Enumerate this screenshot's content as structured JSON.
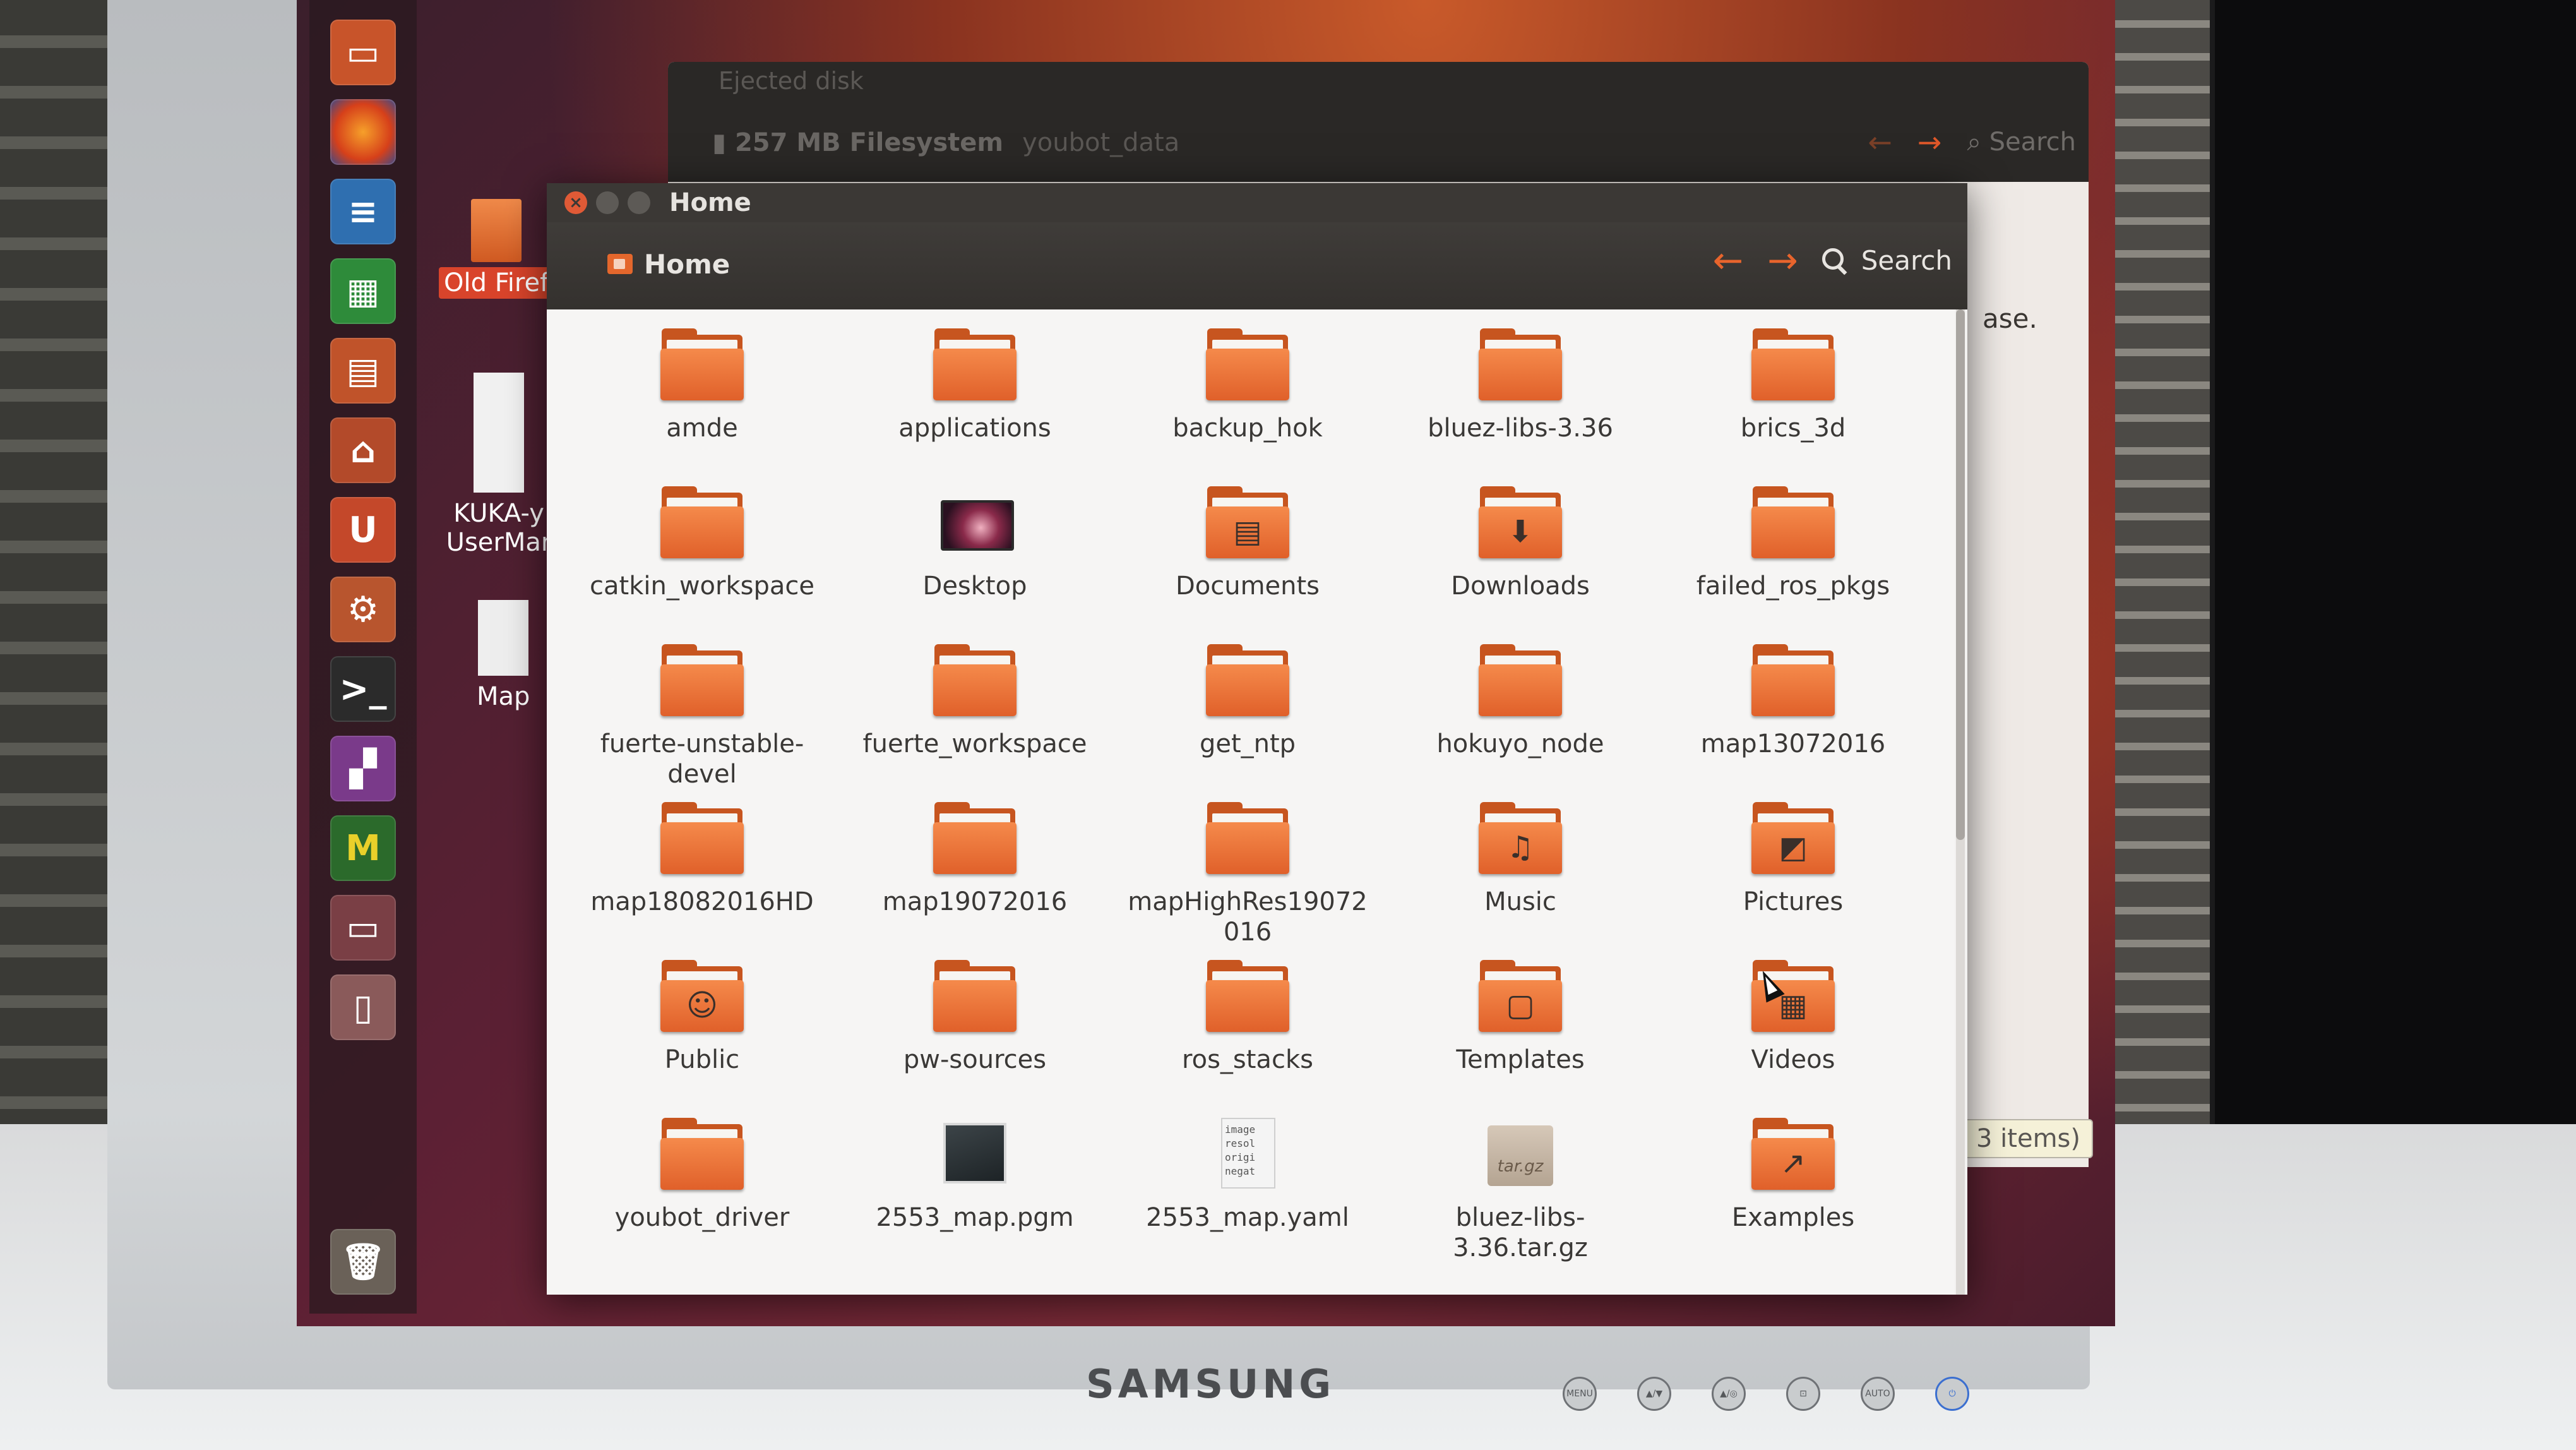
{
  "monitor": {
    "brand": "SAMSUNG",
    "buttons": [
      "MENU",
      "▲/▼",
      "▲/◎",
      "⊡",
      "AUTO",
      "⏻"
    ]
  },
  "launcher": {
    "icons": [
      "ubuntu-files-icon",
      "firefox-icon",
      "writer-icon",
      "calc-icon",
      "impress-icon",
      "ubuntu-software-icon",
      "ubuntu-one-icon",
      "system-settings-icon",
      "terminal-icon",
      "workspace-switcher-icon",
      "matlab-icon",
      "remote-desktop-icon",
      "usb-drive-icon",
      "trash-icon"
    ]
  },
  "desktop": {
    "icons": [
      {
        "label": "Old Firef"
      },
      {
        "label": "KUKA-y UserMar"
      },
      {
        "label": "Map"
      }
    ]
  },
  "background_window": {
    "title": "Ejected disk",
    "path_volume": "257 MB Filesystem",
    "path_folder": "youbot_data",
    "search_label": "Search",
    "side_text": "ase.",
    "status": "3 items)"
  },
  "window": {
    "title": "Home",
    "breadcrumb": "Home",
    "search_label": "Search",
    "items": [
      {
        "label": "amde",
        "kind": "folder"
      },
      {
        "label": "applications",
        "kind": "folder"
      },
      {
        "label": "backup_hok",
        "kind": "folder"
      },
      {
        "label": "bluez-libs-3.36",
        "kind": "folder"
      },
      {
        "label": "brics_3d",
        "kind": "folder"
      },
      {
        "label": "catkin_workspace",
        "kind": "folder"
      },
      {
        "label": "Desktop",
        "kind": "desktop"
      },
      {
        "label": "Documents",
        "kind": "folder",
        "emblem": "documents"
      },
      {
        "label": "Downloads",
        "kind": "folder",
        "emblem": "downloads"
      },
      {
        "label": "failed_ros_pkgs",
        "kind": "folder"
      },
      {
        "label": "fuerte-unstable-devel",
        "kind": "folder"
      },
      {
        "label": "fuerte_workspace",
        "kind": "folder"
      },
      {
        "label": "get_ntp",
        "kind": "folder"
      },
      {
        "label": "hokuyo_node",
        "kind": "folder"
      },
      {
        "label": "map13072016",
        "kind": "folder"
      },
      {
        "label": "map18082016HD",
        "kind": "folder"
      },
      {
        "label": "map19072016",
        "kind": "folder"
      },
      {
        "label": "mapHighRes19072016",
        "kind": "folder"
      },
      {
        "label": "Music",
        "kind": "folder",
        "emblem": "music"
      },
      {
        "label": "Pictures",
        "kind": "folder",
        "emblem": "pictures"
      },
      {
        "label": "Public",
        "kind": "folder",
        "emblem": "public"
      },
      {
        "label": "pw-sources",
        "kind": "folder"
      },
      {
        "label": "ros_stacks",
        "kind": "folder"
      },
      {
        "label": "Templates",
        "kind": "folder",
        "emblem": "templates"
      },
      {
        "label": "Videos",
        "kind": "folder",
        "emblem": "videos"
      },
      {
        "label": "youbot_driver",
        "kind": "folder"
      },
      {
        "label": "2553_map.pgm",
        "kind": "image"
      },
      {
        "label": "2553_map.yaml",
        "kind": "text",
        "preview": "image\nresol\norigi\nnegat"
      },
      {
        "label": "bluez-libs-3.36.tar.gz",
        "kind": "archive",
        "badge": "tar.gz"
      },
      {
        "label": "Examples",
        "kind": "folder",
        "emblem": "link"
      }
    ]
  }
}
